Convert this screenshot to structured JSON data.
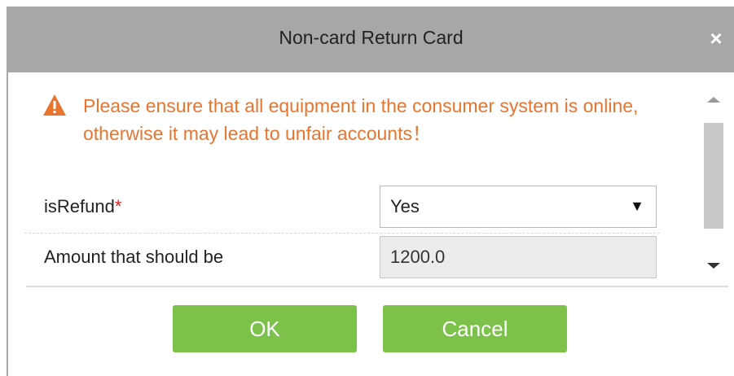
{
  "dialog": {
    "title": "Non-card Return Card",
    "close_label": "×"
  },
  "warning": {
    "text": "Please ensure that all equipment in the consumer system is online, otherwise it may lead to unfair accounts！",
    "icon": "warning-icon",
    "color": "#e8742e"
  },
  "form": {
    "is_refund": {
      "label": "isRefund",
      "required_mark": "*",
      "value": "Yes",
      "arrow": "▼"
    },
    "amount": {
      "label": "Amount that should be",
      "value": "1200.0"
    }
  },
  "buttons": {
    "ok_label": "OK",
    "cancel_label": "Cancel",
    "color": "#7cc24a"
  }
}
